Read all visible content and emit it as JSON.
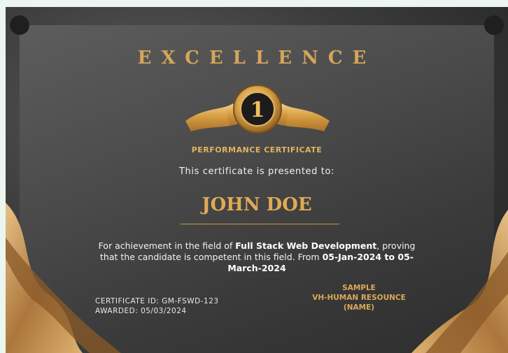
{
  "certificate": {
    "title": "EXCELLENCE",
    "medal_number": "1",
    "subtitle": "PERFORMANCE CERTIFICATE",
    "presented_to": "This certificate is presented to:",
    "recipient_name": "JOHN DOE",
    "description": {
      "part1": "For achievement in the field of ",
      "field": "Full Stack Web Development",
      "part2": ", proving that the candidate is competent in this field. From ",
      "period": "05-Jan-2024 to 05-March-2024"
    },
    "certificate_id": "CERTIFICATE ID: GM-FSWD-123",
    "awarded": "AWARDED: 05/03/2024",
    "signatory": {
      "line1": "SAMPLE",
      "line2": "VH-HUMAN RESOUNCE",
      "line3": "(NAME)"
    }
  },
  "colors": {
    "gold": "#d4a55a",
    "background": "#eaf6ef",
    "dark": "#3b3b3b"
  }
}
